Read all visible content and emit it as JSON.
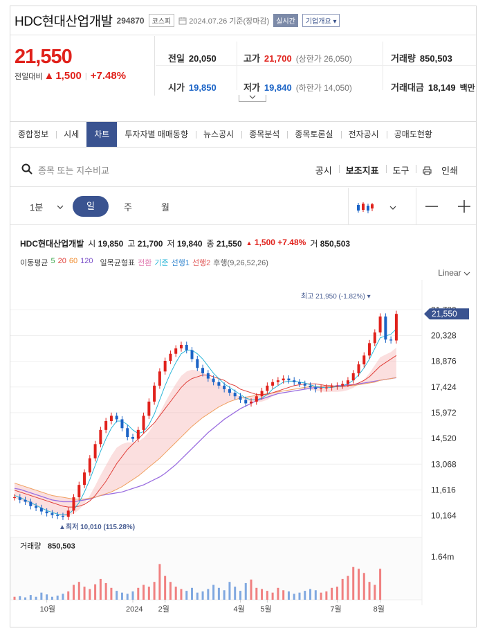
{
  "stock": {
    "name": "HDC현대산업개발",
    "code": "294870",
    "market": "코스피",
    "date": "2024.07.26 기준(장마감)",
    "realtime": "실시간",
    "overview": "기업개요 ▾",
    "price": "21,550",
    "change_label": "전일대비",
    "change_arrow": "▲",
    "change": "1,500",
    "change_pct": "+7.48%"
  },
  "stats": {
    "prev_k": "전일",
    "prev_v": "20,050",
    "high_k": "고가",
    "high_v": "21,700",
    "upper_limit": "(상한가 26,050)",
    "volume_k": "거래량",
    "volume_v": "850,503",
    "open_k": "시가",
    "open_v": "19,850",
    "low_k": "저가",
    "low_v": "19,840",
    "lower_limit": "(하한가 14,050)",
    "amount_k": "거래대금",
    "amount_v": "18,149",
    "amount_unit": "백만"
  },
  "tabs": [
    "종합정보",
    "시세",
    "차트",
    "투자자별 매매동향",
    "뉴스공시",
    "종목분석",
    "종목토론실",
    "전자공시",
    "공매도현황"
  ],
  "search": {
    "placeholder": "종목 또는 지수비교",
    "tools": [
      "공시",
      "보조지표",
      "도구",
      "인쇄"
    ]
  },
  "period": {
    "minute": "1분",
    "day": "일",
    "week": "주",
    "month": "월"
  },
  "chart_info": {
    "name": "HDC현대산업개발",
    "open_k": "시",
    "open_v": "19,850",
    "high_k": "고",
    "high_v": "21,700",
    "low_k": "저",
    "low_v": "19,840",
    "close_k": "종",
    "close_v": "21,550",
    "chg_arrow": "▲",
    "chg": "1,500",
    "chg_pct": "+7.48%",
    "vol_k": "거",
    "vol_v": "850,503"
  },
  "legend": {
    "ma_label": "이동평균",
    "ma": [
      "5",
      "20",
      "60",
      "120"
    ],
    "ma_colors": [
      "#3aa64a",
      "#e0403a",
      "#f08a2a",
      "#7a4fc8"
    ],
    "ichimoku_label": "일목균형표",
    "lines": [
      "전환",
      "기준",
      "선행1",
      "선행2",
      "후행(9,26,52,26)"
    ],
    "line_colors": [
      "#e07ab0",
      "#29b6d8",
      "#3a8ad0",
      "#e05a5a",
      "#888888"
    ]
  },
  "scale": "Linear",
  "annotations": {
    "high": "최고 21,950 (-1.82%)",
    "low": "최저 10,010 (115.28%)",
    "current": "21,550",
    "volume_label": "거래량",
    "volume_value": "850,503",
    "volume_axis": "1.64m"
  },
  "chart_data": {
    "type": "line",
    "ylim": [
      9600,
      22300
    ],
    "yticks": [
      "21,780",
      "20,328",
      "18,876",
      "17,424",
      "15,972",
      "14,520",
      "13,068",
      "11,616",
      "10,164"
    ],
    "ytick_values": [
      21780,
      20328,
      18876,
      17424,
      15972,
      14520,
      13068,
      11616,
      10164
    ],
    "xticks": [
      "10월",
      "2024",
      "2월",
      "4월",
      "5월",
      "7월",
      "8월"
    ],
    "xtick_index": [
      6,
      22,
      28,
      42,
      47,
      60,
      68
    ],
    "n": 76,
    "close": [
      11200,
      11050,
      10950,
      10700,
      10600,
      10400,
      10300,
      10200,
      10150,
      10100,
      10450,
      11200,
      11900,
      12600,
      13400,
      14200,
      15000,
      15500,
      15800,
      15600,
      15100,
      14600,
      14500,
      15000,
      15800,
      16600,
      17500,
      18300,
      18900,
      19300,
      19600,
      19800,
      19500,
      19000,
      18500,
      18200,
      17900,
      17700,
      17500,
      17300,
      17100,
      16900,
      16700,
      16500,
      16600,
      16900,
      17200,
      17500,
      17700,
      17800,
      17900,
      17800,
      17700,
      17600,
      17500,
      17400,
      17300,
      17350,
      17400,
      17450,
      17500,
      17600,
      17800,
      18200,
      18700,
      19200,
      19900,
      20500,
      21400,
      20100,
      20050,
      21550
    ],
    "ma5": [
      11300,
      11200,
      11050,
      10900,
      10750,
      10600,
      10450,
      10350,
      10250,
      10200,
      10250,
      10500,
      10900,
      11500,
      12200,
      13000,
      13800,
      14500,
      15100,
      15500,
      15500,
      15300,
      15000,
      14800,
      14900,
      15300,
      15900,
      16700,
      17500,
      18200,
      18800,
      19300,
      19500,
      19500,
      19300,
      19000,
      18600,
      18200,
      17900,
      17600,
      17400,
      17200,
      17000,
      16800,
      16700,
      16700,
      16800,
      17000,
      17300,
      17500,
      17700,
      17750,
      17750,
      17700,
      17650,
      17550,
      17450,
      17400,
      17380,
      17400,
      17450,
      17500,
      17600,
      17800,
      18100,
      18500,
      19000,
      19600,
      20200,
      20300,
      20400,
      20700
    ],
    "ma20": [
      11600,
      11500,
      11400,
      11300,
      11200,
      11100,
      11000,
      10900,
      10800,
      10700,
      10650,
      10650,
      10700,
      10800,
      11000,
      11300,
      11700,
      12100,
      12600,
      13100,
      13500,
      13900,
      14200,
      14500,
      14800,
      15100,
      15400,
      15800,
      16200,
      16600,
      17000,
      17400,
      17700,
      17900,
      18000,
      18100,
      18100,
      18000,
      17900,
      17800,
      17600,
      17500,
      17300,
      17200,
      17100,
      17000,
      17000,
      17000,
      17100,
      17200,
      17300,
      17400,
      17500,
      17550,
      17600,
      17600,
      17600,
      17550,
      17500,
      17500,
      17450,
      17450,
      17500,
      17550,
      17650,
      17800,
      18000,
      18300,
      18600,
      18800,
      19000,
      19200
    ],
    "ma60": [
      12000,
      11900,
      11800,
      11700,
      11600,
      11500,
      11400,
      11300,
      11250,
      11200,
      11150,
      11100,
      11100,
      11100,
      11150,
      11200,
      11300,
      11400,
      11500,
      11650,
      11800,
      12000,
      12200,
      12400,
      12650,
      12900,
      13150,
      13400,
      13700,
      14000,
      14300,
      14600,
      14900,
      15200,
      15450,
      15700,
      15900,
      16100,
      16300,
      16450,
      16600,
      16700,
      16800,
      16850,
      16900,
      16950,
      17000,
      17050,
      17100,
      17150,
      17200,
      17250,
      17300,
      17350,
      17400,
      17450,
      17450,
      17450,
      17450,
      17450,
      17450,
      17450,
      17500,
      17500,
      17550,
      17600,
      17650,
      17700,
      17800,
      17850,
      17900,
      17950
    ],
    "ma120": [
      11700,
      11650,
      11550,
      11450,
      11350,
      11250,
      11150,
      11050,
      11000,
      10950,
      10950,
      10950,
      11000,
      11050,
      11100,
      11200,
      11300,
      11350,
      11400,
      11450,
      11500,
      11600,
      11700,
      11800,
      11900,
      12050,
      12200,
      12350,
      12550,
      12800,
      13050,
      13350,
      13650,
      13950,
      14250,
      14550,
      14850,
      15100,
      15350,
      15600,
      15800,
      16000,
      16200,
      16350,
      16500,
      16650,
      16750,
      16850,
      16950,
      17050,
      17100,
      17150,
      17200,
      17250,
      17300,
      17350,
      17400,
      17400,
      17450,
      17450,
      17500,
      17500,
      17550,
      17550,
      17600,
      17650,
      17700,
      17750,
      17800,
      17850,
      17900,
      17950
    ],
    "volume": [
      0.05,
      0.06,
      0.04,
      0.08,
      0.05,
      0.12,
      0.09,
      0.05,
      0.07,
      0.1,
      0.14,
      0.25,
      0.3,
      0.22,
      0.18,
      0.26,
      0.35,
      0.28,
      0.2,
      0.15,
      0.12,
      0.1,
      0.14,
      0.2,
      0.25,
      0.22,
      0.3,
      0.6,
      0.4,
      0.3,
      0.22,
      0.18,
      0.15,
      0.2,
      0.12,
      0.14,
      0.18,
      0.25,
      0.2,
      0.16,
      0.3,
      0.22,
      0.15,
      0.28,
      0.34,
      0.2,
      0.18,
      0.15,
      0.12,
      0.2,
      0.16,
      0.14,
      0.1,
      0.12,
      0.15,
      0.18,
      0.16,
      0.12,
      0.14,
      0.2,
      0.22,
      0.35,
      0.4,
      0.55,
      0.52,
      0.45,
      0.3,
      0.25,
      0.52
    ]
  }
}
